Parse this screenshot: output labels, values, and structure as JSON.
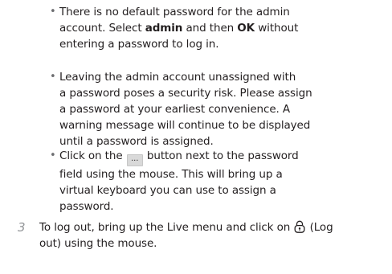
{
  "bullets": [
    {
      "lines": {
        "l1": "There is no default password for the admin",
        "l2_a": "account. Select ",
        "l2_b": "admin",
        "l2_c": " and then ",
        "l2_d": "OK",
        "l2_e": " without",
        "l3": "entering a password to log in."
      }
    },
    {
      "lines": {
        "l1": "Leaving the admin account unassigned with",
        "l2": "a password poses a security risk. Please assign",
        "l3": "a password at your earliest convenience. A",
        "l4": "warning message will continue to be displayed",
        "l5": "until a password is assigned."
      }
    },
    {
      "lines": {
        "l1_a": "Click on the ",
        "l1_button": "...",
        "l1_b": " button next to the password",
        "l2": "field using the mouse. This will bring up a",
        "l3": "virtual keyboard you can use to assign a",
        "l4": "password."
      }
    }
  ],
  "step": {
    "number": "3",
    "line1_a": "To log out, bring up the Live menu and click on ",
    "line1_b": " (Log",
    "line2": "out) using the mouse.",
    "icon": "logout-lock-icon"
  },
  "bullet_glyph": "•"
}
